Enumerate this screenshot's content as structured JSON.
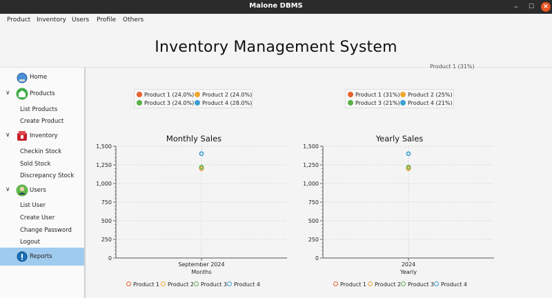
{
  "window": {
    "title": "Malone DBMS"
  },
  "menu": [
    "Product",
    "Inventory",
    "Users",
    "Profile",
    "Others"
  ],
  "header": {
    "title": "Inventory Management System"
  },
  "sidebar": {
    "home": "Home",
    "products": {
      "label": "Products",
      "items": [
        "List Products",
        "Create Product"
      ]
    },
    "inventory": {
      "label": "Inventory",
      "items": [
        "Checkin Stock",
        "Sold Stock",
        "Discrepancy Stock"
      ]
    },
    "users": {
      "label": "Users",
      "items": [
        "List User",
        "Create User",
        "Change Password",
        "Logout"
      ]
    },
    "reports": "Reports"
  },
  "colors": {
    "p1": "#e8622c",
    "p2": "#f0a52e",
    "p3": "#5bb04a",
    "p4": "#3a9fd0",
    "selected": "#9fcbef"
  },
  "pie_legends": {
    "left": [
      "Product 1 (24.0%)",
      "Product 2 (24.0%)",
      "Product 3 (24.0%)",
      "Product 4 (28.0%)"
    ],
    "right": [
      "Product 1 (31%)",
      "Product 2 (25%)",
      "Product 3 (21%)",
      "Product 4 (21%)"
    ],
    "clipped_label": "Product 1 (31%)"
  },
  "chart_data": [
    {
      "type": "scatter",
      "title": "Monthly Sales",
      "xlabel": "Months",
      "ylabel": "",
      "categories": [
        "September 2024"
      ],
      "ylim": [
        0,
        1500
      ],
      "yticks": [
        "0",
        "250",
        "500",
        "750",
        "1,000",
        "1,250",
        "1,500"
      ],
      "series": [
        {
          "name": "Product 1",
          "values": [
            1200
          ]
        },
        {
          "name": "Product 2",
          "values": [
            1200
          ]
        },
        {
          "name": "Product 3",
          "values": [
            1220
          ]
        },
        {
          "name": "Product 4",
          "values": [
            1400
          ]
        }
      ],
      "grid": true,
      "legend": "bottom"
    },
    {
      "type": "scatter",
      "title": "Yearly Sales",
      "xlabel": "Yearly",
      "ylabel": "",
      "categories": [
        "2024"
      ],
      "ylim": [
        0,
        1500
      ],
      "yticks": [
        "0",
        "250",
        "500",
        "750",
        "1,000",
        "1,250",
        "1,500"
      ],
      "series": [
        {
          "name": "Product 1",
          "values": [
            1200
          ]
        },
        {
          "name": "Product 2",
          "values": [
            1200
          ]
        },
        {
          "name": "Product 3",
          "values": [
            1220
          ]
        },
        {
          "name": "Product 4",
          "values": [
            1400
          ]
        }
      ],
      "grid": true,
      "legend": "bottom"
    }
  ]
}
